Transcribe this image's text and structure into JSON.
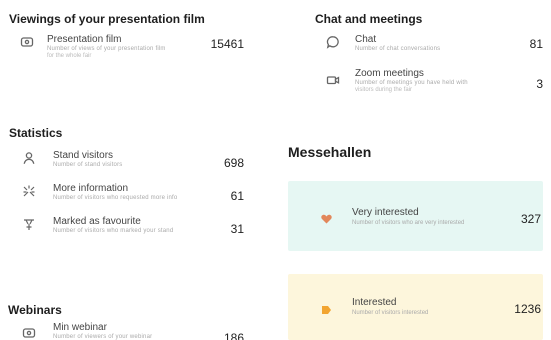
{
  "viewings": {
    "title": "Viewings of your presentation film",
    "items": [
      {
        "label": "Presentation film",
        "desc": "Number of views of your presentation film",
        "desc2": "for the whole fair",
        "value": "15461"
      }
    ]
  },
  "chat": {
    "title": "Chat and meetings",
    "items": [
      {
        "label": "Chat",
        "desc": "Number of chat conversations",
        "value": "81"
      },
      {
        "label": "Zoom meetings",
        "desc": "Number of meetings you have held with",
        "desc2": "visitors during the fair",
        "value": "3"
      }
    ]
  },
  "statistics": {
    "title": "Statistics",
    "items": [
      {
        "label": "Stand visitors",
        "desc": "Number of stand visitors",
        "value": "698"
      },
      {
        "label": "More information",
        "desc": "Number of visitors who requested more info",
        "value": "61"
      },
      {
        "label": "Marked as favourite",
        "desc": "Number of visitors who marked your stand",
        "value": "31"
      }
    ]
  },
  "messehallen": {
    "title": "Messehallen",
    "cards": [
      {
        "label": "Very interested",
        "desc": "Number of visitors who are very interested",
        "value": "327",
        "color": "#e6f7f3",
        "icon_color": "#e2875a"
      },
      {
        "label": "Interested",
        "desc": "Number of visitors interested",
        "value": "1236",
        "color": "#fdf6dc",
        "icon_color": "#f2a531"
      }
    ]
  },
  "webinars": {
    "title": "Webinars",
    "items": [
      {
        "label": "Min webinar",
        "desc": "Number of viewers of your webinar",
        "value": "186"
      }
    ]
  }
}
